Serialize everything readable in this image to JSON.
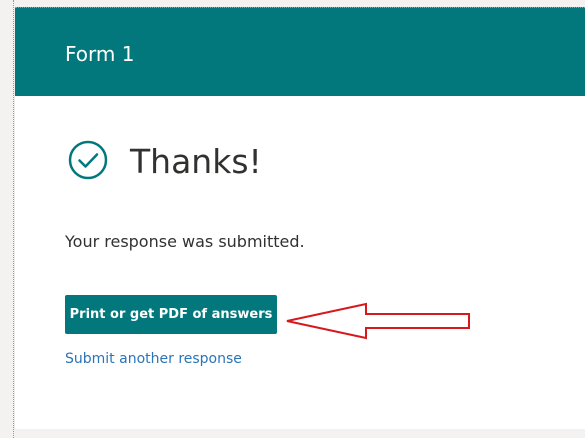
{
  "form": {
    "title": "Form 1"
  },
  "confirmation": {
    "heading": "Thanks!",
    "message": "Your response was submitted.",
    "icon": "check-circle-icon"
  },
  "actions": {
    "print_pdf_label": "Print or get PDF of answers",
    "submit_another_label": "Submit another response"
  },
  "colors": {
    "brand": "#03787c",
    "link": "#2b74b8",
    "annotation": "#d7191c"
  }
}
